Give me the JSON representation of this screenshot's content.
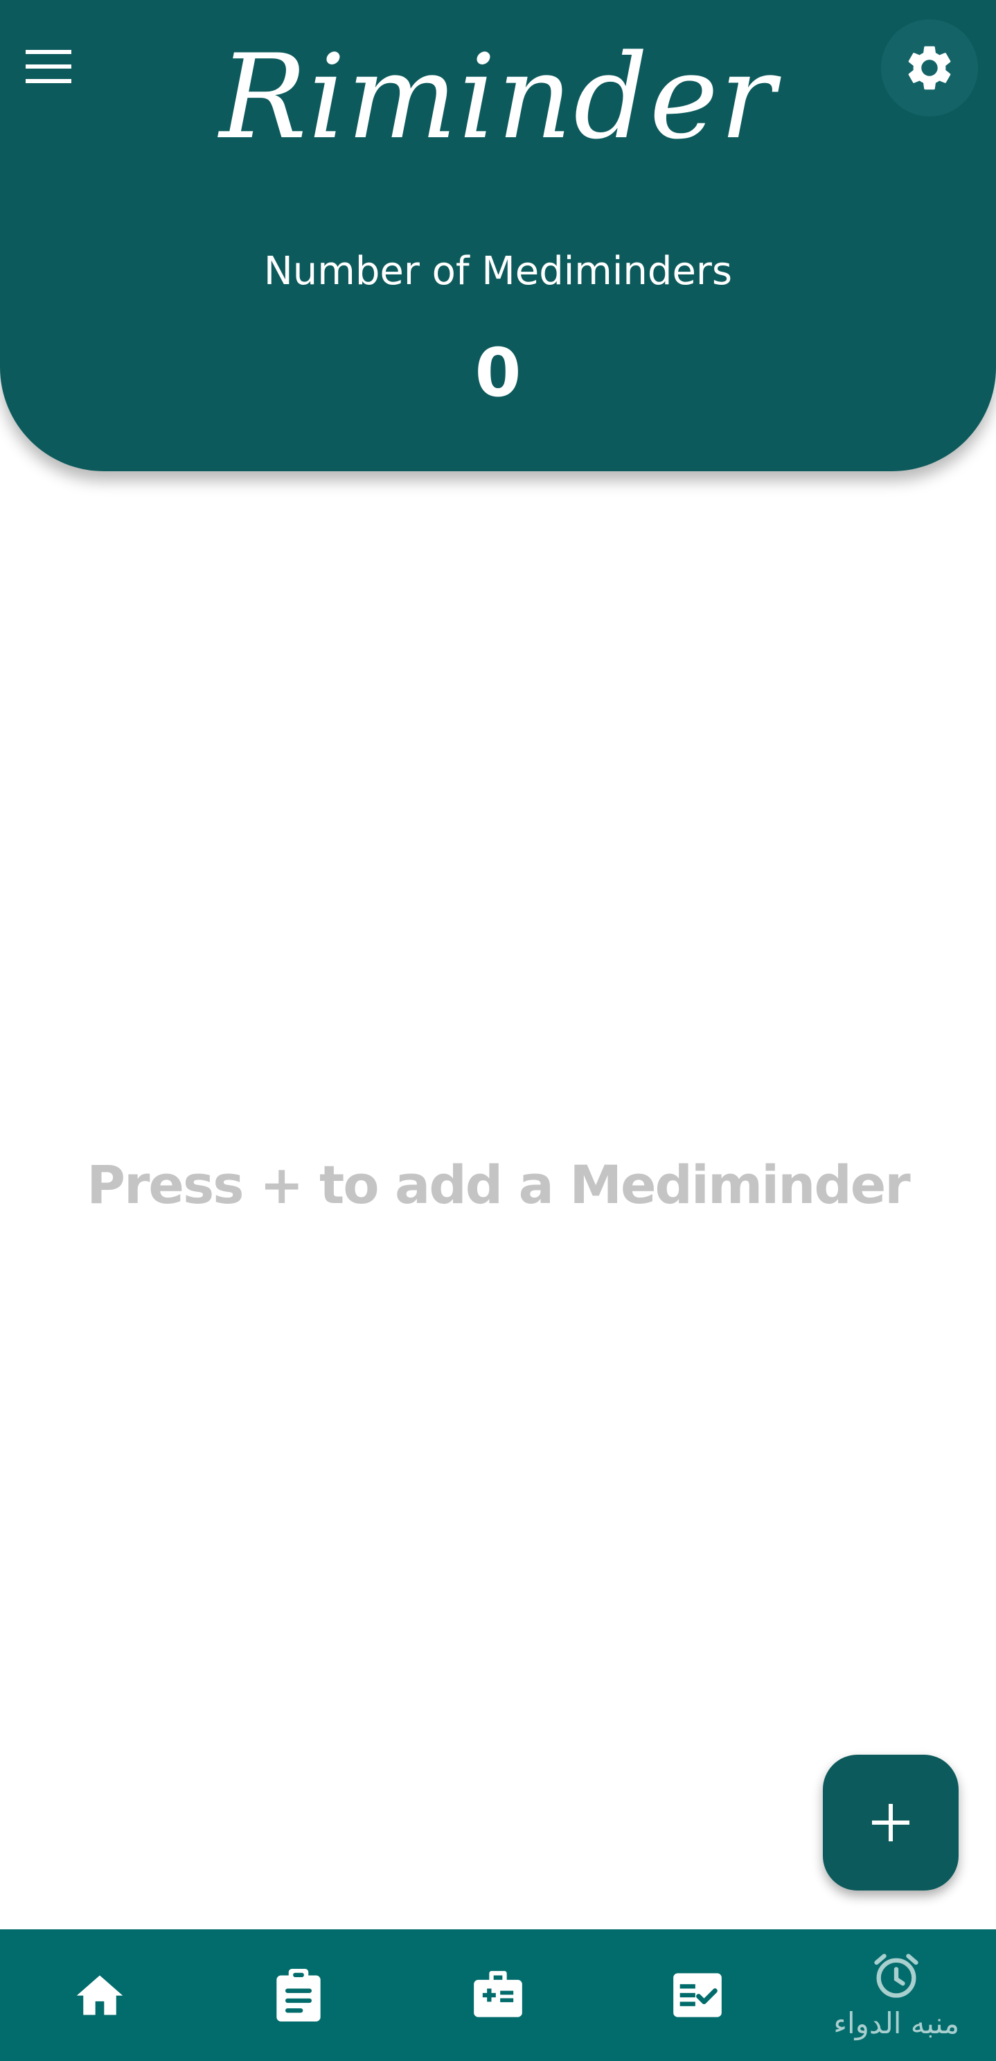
{
  "header": {
    "app_title": "Riminder",
    "count_label": "Number of Mediminders",
    "count_value": "0",
    "menu_icon": "hamburger-menu-icon",
    "settings_icon": "gear-icon"
  },
  "main": {
    "empty_hint": "Press + to add a Mediminder"
  },
  "fab": {
    "icon": "plus-icon"
  },
  "bottom_nav": {
    "items": [
      {
        "icon": "home-icon"
      },
      {
        "icon": "clipboard-icon"
      },
      {
        "icon": "medical-kit-icon"
      },
      {
        "icon": "checklist-icon"
      },
      {
        "icon": "alarm-clock-icon",
        "label": "منبه الدواء"
      }
    ]
  },
  "colors": {
    "header_bg": "#0d5a5c",
    "nav_bg": "#026b6b",
    "fab_bg": "#0d5a5c",
    "hint_text": "#c4c4c4",
    "nav_inactive": "#a9cfcf"
  }
}
